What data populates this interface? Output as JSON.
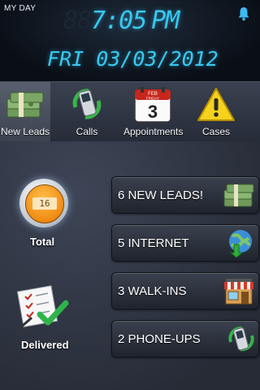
{
  "header": {
    "app_title": "MY DAY",
    "clock_dim_digits": "88",
    "time": "7:05",
    "ampm": "PM",
    "date": "FRI 03/03/2012",
    "bell_icon": "bell-icon",
    "accent_color": "#38c8f2"
  },
  "nav": {
    "items": [
      {
        "label": "New Leads",
        "icon": "money-stack-icon",
        "active": true
      },
      {
        "label": "Calls",
        "icon": "phone-icon",
        "active": false
      },
      {
        "label": "Appointments",
        "icon": "calendar-icon",
        "active": false
      },
      {
        "label": "Cases",
        "icon": "warning-icon",
        "active": false
      }
    ],
    "calendar": {
      "month": "FEB",
      "weekday": "FRIDAY",
      "day": "3"
    }
  },
  "summary": {
    "total_label": "Total",
    "total_count": "16",
    "delivered_label": "Delivered"
  },
  "leads": [
    {
      "label": "6 NEW LEADS!",
      "icon": "money-stack-icon"
    },
    {
      "label": "5 INTERNET",
      "icon": "globe-download-icon"
    },
    {
      "label": "3 WALK-INS",
      "icon": "storefront-icon"
    },
    {
      "label": "2 PHONE-UPS",
      "icon": "phone-icon"
    }
  ]
}
